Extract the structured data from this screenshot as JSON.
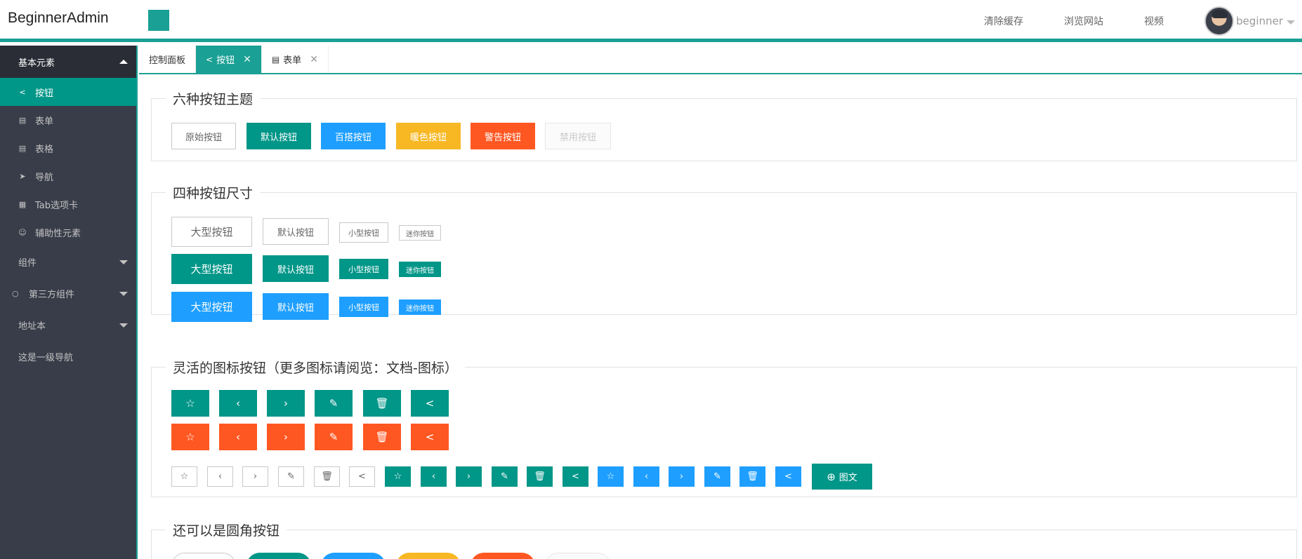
{
  "header": {
    "logo": "BeginnerAdmin",
    "nav": [
      "清除缓存",
      "浏览网站",
      "视频"
    ],
    "user": "beginner"
  },
  "sidebar": {
    "group": "基本元素",
    "items": [
      {
        "icon": "share-icon",
        "label": "按钮"
      },
      {
        "icon": "form-icon",
        "label": "表单"
      },
      {
        "icon": "table-icon",
        "label": "表格"
      },
      {
        "icon": "nav-icon",
        "label": "导航"
      },
      {
        "icon": "tab-icon",
        "label": "Tab选项卡"
      },
      {
        "icon": "smile-icon",
        "label": "辅助性元素"
      }
    ],
    "menus": [
      {
        "label": "组件"
      },
      {
        "label": "第三方组件"
      },
      {
        "label": "地址本"
      },
      {
        "label": "这是一级导航"
      }
    ]
  },
  "tabs": [
    {
      "label": "控制面板"
    },
    {
      "label": "按钮"
    },
    {
      "label": "表单"
    }
  ],
  "sections": {
    "themes": {
      "title": "六种按钮主题",
      "buttons": [
        "原始按钮",
        "默认按钮",
        "百搭按钮",
        "暖色按钮",
        "警告按钮",
        "禁用按钮"
      ]
    },
    "sizes": {
      "title": "四种按钮尺寸",
      "labels": [
        "大型按钮",
        "默认按钮",
        "小型按钮",
        "迷你按钮"
      ]
    },
    "icons": {
      "title": "灵活的图标按钮（更多图标请阅览：文档-图标）",
      "glyphs": [
        "☆",
        "‹",
        "›",
        "✎",
        "🗑",
        "<"
      ],
      "glyph_names": [
        "star-icon",
        "chevron-left-icon",
        "chevron-right-icon",
        "edit-icon",
        "delete-icon",
        "share-icon"
      ],
      "text_button": "图文"
    },
    "round": {
      "title": "还可以是圆角按钮"
    }
  },
  "colors": {
    "accent": "#1aa094",
    "default": "#009688",
    "normal": "#1e9fff",
    "warm": "#f7b824",
    "danger": "#ff5722",
    "sidebar": "#393d49"
  }
}
